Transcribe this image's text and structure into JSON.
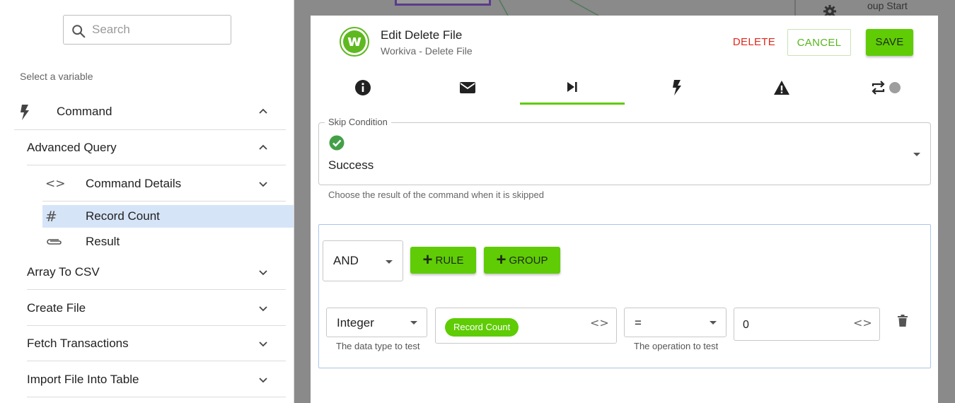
{
  "sidebar": {
    "search_placeholder": "Search",
    "select_label": "Select a variable",
    "command": {
      "label": "Command",
      "icon": "bolt-icon"
    },
    "items": [
      {
        "label": "Advanced Query"
      },
      {
        "label": "Command Details",
        "icon": "code-icon"
      },
      {
        "label": "Record Count",
        "icon": "hash-icon",
        "selected": true
      },
      {
        "label": "Result",
        "icon": "paperclip-icon"
      },
      {
        "label": "Array To CSV"
      },
      {
        "label": "Create File"
      },
      {
        "label": "Fetch Transactions"
      },
      {
        "label": "Import File Into Table"
      }
    ]
  },
  "background": {
    "partial_text": "oup Start"
  },
  "modal": {
    "title": "Edit Delete File",
    "subtitle": "Workiva - Delete File",
    "logo_letter": "w",
    "actions": {
      "delete": "DELETE",
      "cancel": "CANCEL",
      "save": "SAVE"
    },
    "tabs": [
      {
        "icon": "info-icon"
      },
      {
        "icon": "mail-icon"
      },
      {
        "icon": "skip-next-icon",
        "active": true
      },
      {
        "icon": "bolt-icon"
      },
      {
        "icon": "warning-icon"
      },
      {
        "icon": "repeat-icon"
      }
    ],
    "skip_condition": {
      "legend": "Skip Condition",
      "value": "Success",
      "help": "Choose the result of the command when it is skipped"
    },
    "rules": {
      "combinator": "AND",
      "add_rule_label": "RULE",
      "add_group_label": "GROUP",
      "rule": {
        "data_type": "Integer",
        "data_type_help": "The data type to test",
        "variable_chip": "Record Count",
        "operator": "=",
        "operator_help": "The operation to test",
        "value": "0"
      }
    }
  },
  "colors": {
    "accent_green": "#5fcc06",
    "delete_red": "#e0281d",
    "selected_row": "#d6e4f7",
    "rule_border": "#a9c6e8"
  }
}
